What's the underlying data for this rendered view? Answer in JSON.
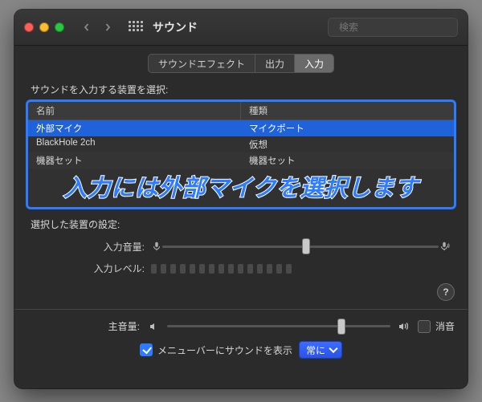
{
  "titlebar": {
    "title": "サウンド",
    "search_placeholder": "検索"
  },
  "tabs": [
    {
      "label": "サウンドエフェクト",
      "active": false
    },
    {
      "label": "出力",
      "active": false
    },
    {
      "label": "入力",
      "active": true
    }
  ],
  "input_section": {
    "select_device_label": "サウンドを入力する装置を選択:",
    "columns": {
      "name": "名前",
      "type": "種類"
    },
    "devices": [
      {
        "name": "外部マイク",
        "type": "マイクポート",
        "selected": true
      },
      {
        "name": "BlackHole 2ch",
        "type": "仮想",
        "selected": false
      },
      {
        "name": "機器セット",
        "type": "機器セット",
        "selected": false
      }
    ],
    "annotation_text": "入力には外部マイクを選択します"
  },
  "selected_device_settings": {
    "heading": "選択した装置の設定:",
    "input_volume_label": "入力音量:",
    "input_volume_value": 0.52,
    "input_level_label": "入力レベル:",
    "level_segments": 15
  },
  "footer": {
    "main_volume_label": "主音量:",
    "main_volume_value": 0.78,
    "mute_label": "消音",
    "mute_checked": false,
    "menubar_label": "メニューバーにサウンドを表示",
    "menubar_checked": true,
    "menubar_popup_value": "常に"
  }
}
